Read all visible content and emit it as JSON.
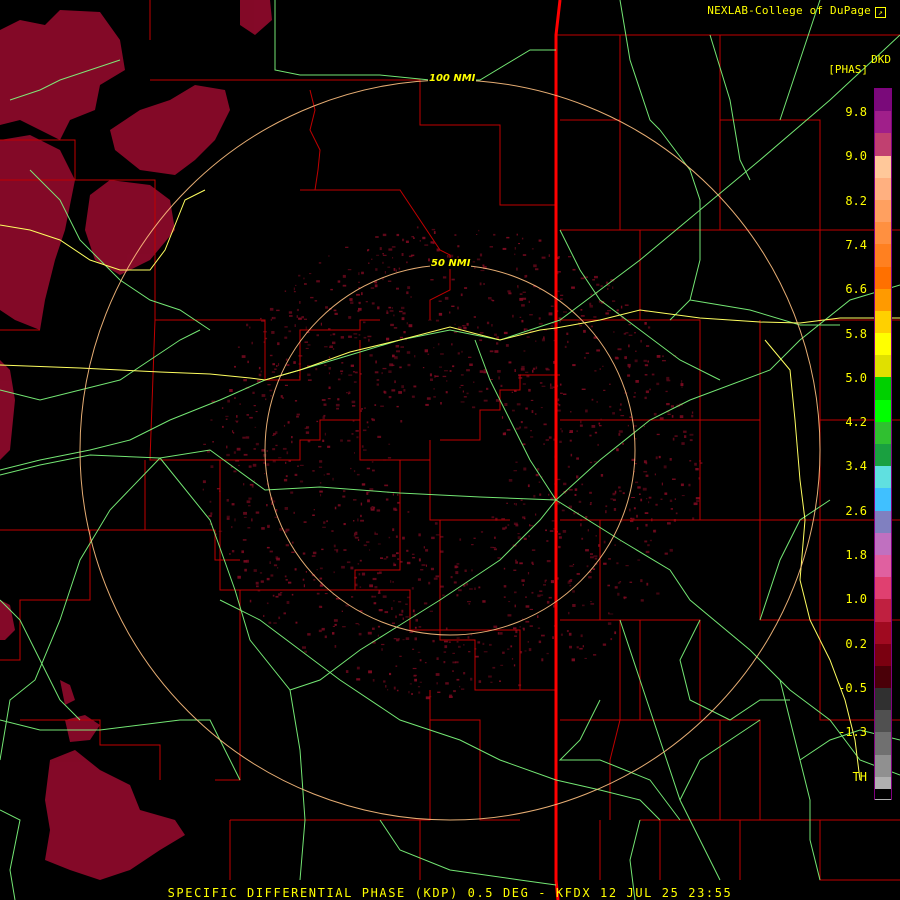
{
  "header": {
    "credit": "NEXLAB-College of DuPage"
  },
  "footer": {
    "caption": "SPECIFIC DIFFERENTIAL PHASE (KDP) 0.5 DEG - KFDX 12 JUL 25 23:55"
  },
  "map": {
    "rings": [
      {
        "label": "100 NMI"
      },
      {
        "label": "50 NMI"
      }
    ],
    "colors": {
      "background": "#000000",
      "county_lines": "#c00000",
      "state_line": "#ff0000",
      "highways": "#80ff80",
      "interstate": "#ffff60",
      "range_rings": "#ffc080",
      "echo": "#8b0a2a"
    }
  },
  "legend": {
    "product": "DKD",
    "unit": "[PHAS]",
    "ticks": [
      "9.8",
      "9.0",
      "8.2",
      "7.4",
      "6.6",
      "5.8",
      "5.0",
      "4.2",
      "3.4",
      "2.6",
      "1.8",
      "1.0",
      "0.2",
      "-0.5",
      "-1.3",
      "TH"
    ],
    "colors": [
      "#7a0a7a",
      "#a01f8a",
      "#c14070",
      "#ffc89a",
      "#ffb080",
      "#ffa060",
      "#ff9040",
      "#ff8020",
      "#ff7000",
      "#ff9a00",
      "#ffd000",
      "#ffff00",
      "#e0e000",
      "#00d000",
      "#00ff00",
      "#30c030",
      "#1aa040",
      "#60e0e0",
      "#40c0ff",
      "#8080c0",
      "#c070c0",
      "#e060a0",
      "#e04070",
      "#c02040",
      "#a00a20",
      "#7a0010",
      "#4a0008",
      "#303030",
      "#505050",
      "#707070",
      "#909090",
      "#b0b0b0"
    ]
  }
}
